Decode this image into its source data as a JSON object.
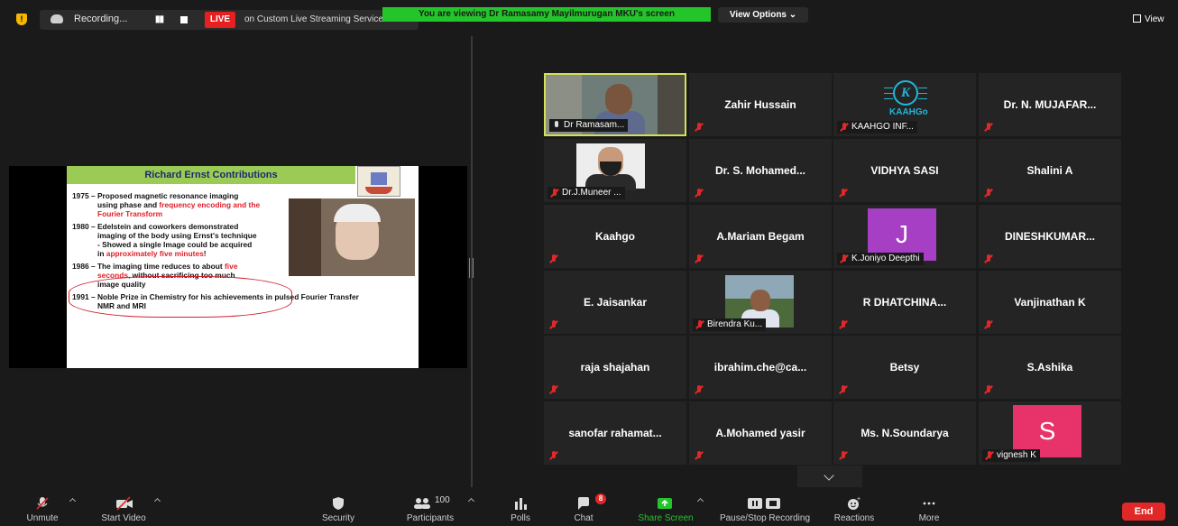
{
  "topbar": {
    "recording_label": "Recording...",
    "live_badge": "LIVE",
    "live_service": "on Custom Live Streaming Service",
    "viewing_banner": "You are viewing Dr Ramasamy Mayilmurugan MKU's screen",
    "view_options": "View Options ⌄",
    "view_button": "View"
  },
  "slide": {
    "title": "Richard Ernst Contributions",
    "lines": [
      {
        "plain": "1975 – Proposed magnetic resonance imaging",
        "red": ""
      },
      {
        "plain": "using phase and ",
        "red": "frequency encoding and the"
      },
      {
        "plain": "",
        "red": "Fourier Transform"
      },
      {
        "plain": "1980 – Edelstein and coworkers demonstrated",
        "red": ""
      },
      {
        "plain": "imaging of  the body using Ernst's technique",
        "red": ""
      },
      {
        "plain": "- Showed a single Image could be acquired",
        "red": ""
      },
      {
        "plain": "in ",
        "red": "approximately five minutes",
        "tail": "!"
      },
      {
        "plain": "1986 – The imaging time reduces to about ",
        "red": "five"
      },
      {
        "plain": "",
        "red": "seconds,",
        "tail": "  without sacrificing too much"
      },
      {
        "plain": "image quality",
        "red": ""
      },
      {
        "plain": "1991 – Noble Prize in Chemistry for his achievements in pulsed  Fourier Transfer",
        "red": ""
      },
      {
        "plain": "NMR and MRI",
        "red": ""
      }
    ]
  },
  "gallery": {
    "tiles": [
      {
        "name": "Dr Ramasam...",
        "kind": "video"
      },
      {
        "name": "Zahir Hussain",
        "kind": "name"
      },
      {
        "name": "KAAHGO INF...",
        "kind": "logo",
        "logo_letter": "K",
        "logo_word": "KAAHGo"
      },
      {
        "name": "Dr. N. MUJAFAR...",
        "kind": "name"
      },
      {
        "name": "Dr.J.Muneer ...",
        "kind": "portrait"
      },
      {
        "name": "Dr. S. Mohamed...",
        "kind": "name"
      },
      {
        "name": "VIDHYA SASI",
        "kind": "name"
      },
      {
        "name": "Shalini A",
        "kind": "name"
      },
      {
        "name": "Kaahgo",
        "kind": "name"
      },
      {
        "name": "A.Mariam Begam",
        "kind": "name"
      },
      {
        "name": "K.Joniyo Deepthi",
        "kind": "avatar",
        "initial": "J",
        "color": "#a63fc4"
      },
      {
        "name": "DINESHKUMAR...",
        "kind": "name"
      },
      {
        "name": "E. Jaisankar",
        "kind": "name"
      },
      {
        "name": "Birendra Ku...",
        "kind": "outdoor"
      },
      {
        "name": "R  DHATCHINA...",
        "kind": "name"
      },
      {
        "name": "Vanjinathan K",
        "kind": "name"
      },
      {
        "name": "raja shajahan",
        "kind": "name"
      },
      {
        "name": "ibrahim.che@ca...",
        "kind": "name"
      },
      {
        "name": "Betsy",
        "kind": "name"
      },
      {
        "name": "S.Ashika",
        "kind": "name"
      },
      {
        "name": "sanofar  rahamat...",
        "kind": "name"
      },
      {
        "name": "A.Mohamed yasir",
        "kind": "name"
      },
      {
        "name": "Ms. N.Soundarya",
        "kind": "name"
      },
      {
        "name": "vignesh K",
        "kind": "avatar",
        "initial": "S",
        "color": "#e8336a"
      }
    ]
  },
  "toolbar": {
    "unmute": "Unmute",
    "start_video": "Start Video",
    "security": "Security",
    "participants": "Participants",
    "participants_count": "100",
    "polls": "Polls",
    "chat": "Chat",
    "chat_badge": "8",
    "share_screen": "Share Screen",
    "pause_recording": "Pause/Stop Recording",
    "reactions": "Reactions",
    "more": "More",
    "end": "End"
  },
  "colors": {
    "accent_green": "#23c52a",
    "danger_red": "#e02828",
    "active_speaker": "#d4e157",
    "tile_bg": "#242424"
  }
}
